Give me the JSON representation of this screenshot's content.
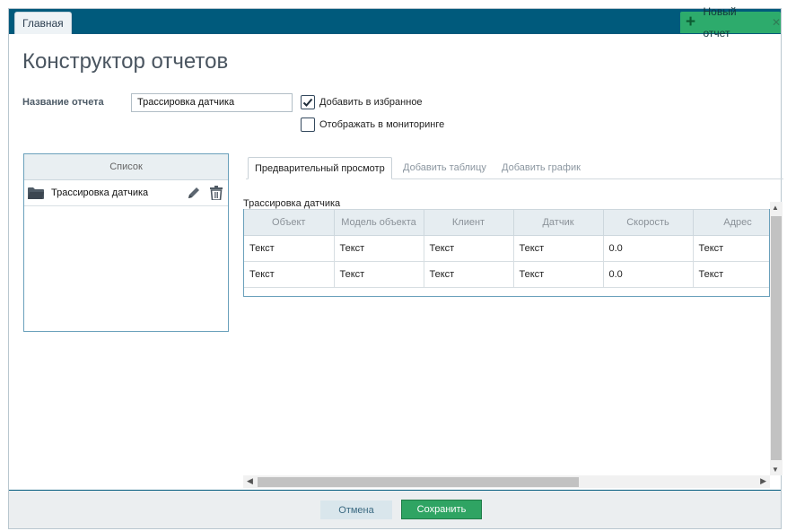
{
  "topbar": {
    "home_tab": "Главная",
    "new_tab": "Новый отчет",
    "close_glyph": "✕"
  },
  "page": {
    "title": "Конструктор отчетов"
  },
  "form": {
    "name_label": "Название отчета",
    "name_value": "Трассировка датчика",
    "favorite_label": "Добавить в избранное",
    "favorite_checked": true,
    "monitoring_label": "Отображать в мониторинге",
    "monitoring_checked": false
  },
  "list": {
    "header": "Список",
    "items": [
      {
        "label": "Трассировка датчика"
      }
    ]
  },
  "tabs": [
    {
      "label": "Предварительный просмотр",
      "active": true
    },
    {
      "label": "Добавить таблицу",
      "active": false
    },
    {
      "label": "Добавить график",
      "active": false
    }
  ],
  "preview": {
    "caption": "Трассировка датчика",
    "columns": [
      "Объект",
      "Модель объекта",
      "Клиент",
      "Датчик",
      "Скорость",
      "Адрес",
      ""
    ],
    "rows": [
      [
        "Текст",
        "Текст",
        "Текст",
        "Текст",
        "0.0",
        "Текст",
        ""
      ],
      [
        "Текст",
        "Текст",
        "Текст",
        "Текст",
        "0.0",
        "Текст",
        ""
      ]
    ]
  },
  "footer": {
    "cancel_label": "Отмена",
    "save_label": "Сохранить"
  },
  "colors": {
    "header_bar": "#005a7c",
    "accent_green": "#2fa463",
    "panel_border": "#6aa0bb"
  },
  "icons": [
    "plus-icon",
    "close-icon",
    "check-icon",
    "folder-icon",
    "pencil-icon",
    "trash-icon"
  ]
}
